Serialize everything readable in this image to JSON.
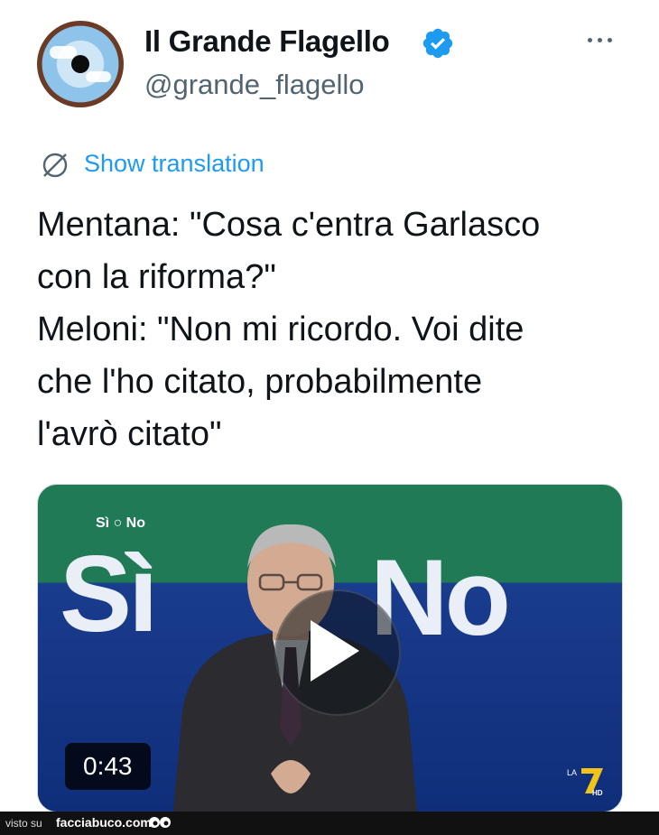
{
  "tweet": {
    "display_name": "Il Grande Flagello",
    "handle": "@grande_flagello",
    "verified_icon": "verified-badge-icon",
    "more_icon": "more-options-icon",
    "show_translation": "Show translation",
    "text_lines": [
      "Mentana: \"Cosa c'entra Garlasco",
      "con la riforma?\"",
      "Meloni: \"Non mi ricordo. Voi dite",
      "che l'ho citato, probabilmente",
      "l'avrò citato\""
    ]
  },
  "media": {
    "duration": "0:43",
    "logo_small": "Sì ○ No",
    "big_si": "Sì",
    "big_no": "No",
    "play_icon": "play-icon",
    "channel_logo": "LA7 HD"
  },
  "watermark": {
    "visto_su": "visto su",
    "site": "facciabuco.com"
  },
  "colors": {
    "accent": "#1d9bf0",
    "text": "#0f1419",
    "secondary": "#536471"
  }
}
